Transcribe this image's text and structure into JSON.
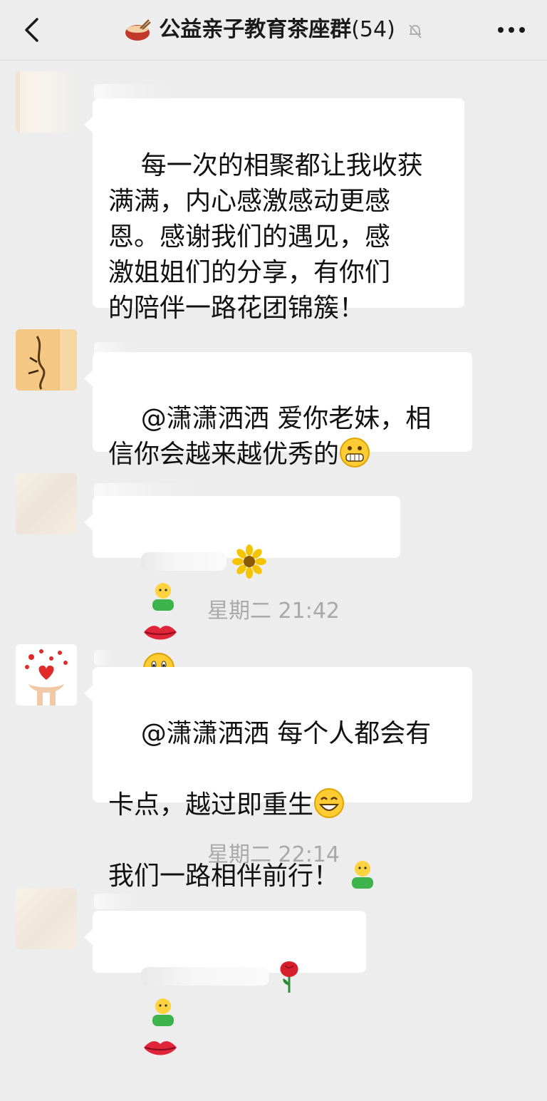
{
  "header": {
    "title_icon": "hotpot-icon",
    "title": "公益亲子教育茶座群",
    "member_count": "(54)",
    "mute_icon": "bell-mute-icon",
    "back_icon": "chevron-left-icon",
    "more_icon": "more-dots-icon"
  },
  "messages": [
    {
      "text": "每一次的相聚都让我收获\n满满，内心感激感动更感\n恩。感谢我们的遇见，感\n激姐姐们的分享，有你们\n的陪伴一路花团锦簇！"
    },
    {
      "text": "@潇潇洒洒 爱你老妹，相\n信你会越来越优秀的",
      "emoji": [
        "grinning-face"
      ]
    },
    {
      "text": "",
      "emoji": [
        "sunflower",
        "person",
        "lips",
        "smiley"
      ]
    },
    {
      "text_line1": "@潇潇洒洒 每个人都会有",
      "text_line2": "卡点，越过即重生",
      "text_line3": "我们一路相伴前行！",
      "emoji": [
        "laughing-face",
        "person"
      ]
    },
    {
      "text": "",
      "emoji": [
        "rose",
        "person",
        "lips"
      ]
    }
  ],
  "timestamps": [
    "星期二 21:42",
    "星期二 22:14"
  ]
}
